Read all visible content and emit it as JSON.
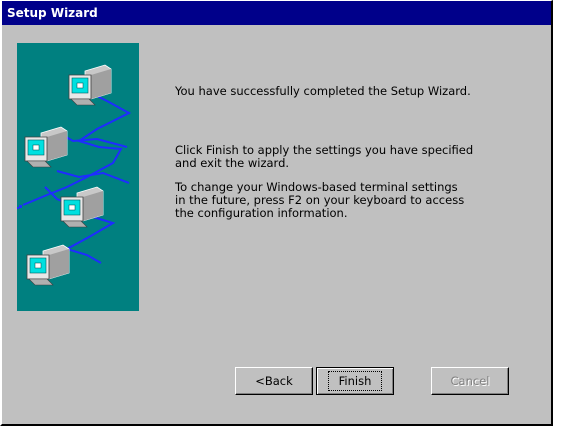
{
  "window": {
    "title": "Setup Wizard"
  },
  "illustration": {
    "icon": "networked-terminals-icon",
    "background_color": "#008080"
  },
  "messages": {
    "completed": "You have successfully completed the Setup Wizard.",
    "finish_instructions": "Click Finish to apply the settings you have specified\nand exit the wizard.",
    "change_settings": "To change your Windows-based terminal settings\nin the future, press F2 on your keyboard to access\nthe configuration information."
  },
  "buttons": {
    "back": "<Back",
    "finish": "Finish",
    "cancel": "Cancel",
    "cancel_enabled": false
  },
  "colors": {
    "titlebar": "#00008a",
    "dialog_face": "#c0c0c0",
    "network_line": "#0000ff"
  }
}
